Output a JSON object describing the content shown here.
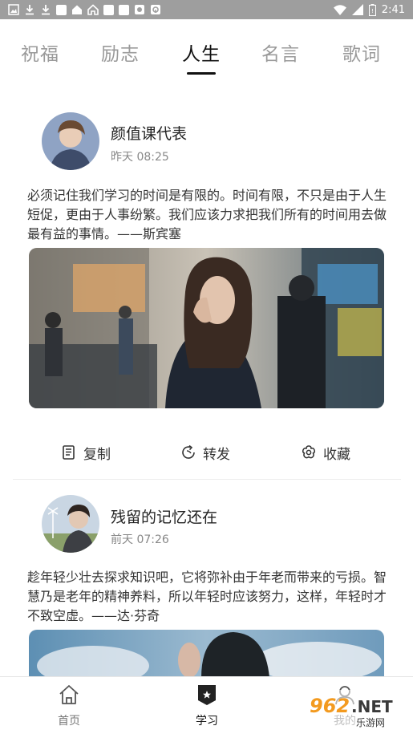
{
  "status_bar": {
    "time": "2:41"
  },
  "tabs": [
    {
      "label": "祝福"
    },
    {
      "label": "励志"
    },
    {
      "label": "人生",
      "active": true
    },
    {
      "label": "名言"
    },
    {
      "label": "歌词"
    }
  ],
  "posts": [
    {
      "author": "颜值课代表",
      "time": "昨天 08:25",
      "quote": "必须记住我们学习的时间是有限的。时间有限，不只是由于人生短促，更由于人事纷繁。我们应该力求把我们所有的时间用去做最有益的事情。——斯宾塞"
    },
    {
      "author": "残留的记忆还在",
      "time": "前天 07:26",
      "quote": "趁年轻少壮去探求知识吧，它将弥补由于年老而带来的亏损。智慧乃是老年的精神养料，所以年轻时应该努力，这样，年轻时才不致空虚。——达·芬奇"
    }
  ],
  "actions": {
    "copy": "复制",
    "forward": "转发",
    "favorite": "收藏"
  },
  "bottom_nav": [
    {
      "label": "首页",
      "icon": "home-icon"
    },
    {
      "label": "学习",
      "icon": "study-icon",
      "active": true
    },
    {
      "label": "我的",
      "icon": "profile-icon"
    }
  ],
  "watermark": {
    "text": "962.NET",
    "sub": "乐游网"
  }
}
